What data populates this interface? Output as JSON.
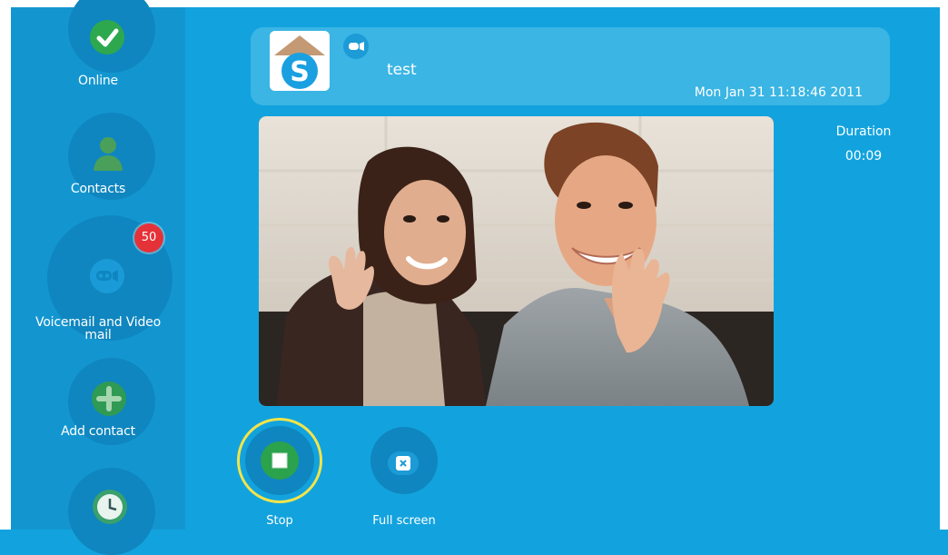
{
  "sidebar": {
    "items": [
      {
        "label": "Online",
        "icon": "online-check-icon"
      },
      {
        "label": "Contacts",
        "icon": "contacts-icon"
      },
      {
        "label": "Voicemail and Video mail",
        "icon": "voicemail-icon",
        "badge": "50"
      },
      {
        "label": "Add contact",
        "icon": "add-contact-icon"
      },
      {
        "label": "",
        "icon": "history-clock-icon"
      }
    ]
  },
  "call": {
    "contact_name": "test",
    "timestamp": "Mon Jan 31 11:18:46 2011",
    "type_icon": "video-call-icon",
    "duration_label": "Duration",
    "duration_value": "00:09"
  },
  "controls": {
    "stop_label": "Stop",
    "fullscreen_label": "Full screen"
  },
  "colors": {
    "background": "#12a3de",
    "sidebar": "#1396d0",
    "accent_green": "#2ba24c",
    "badge_red": "#e53238",
    "focus_ring": "#f3e44a"
  }
}
